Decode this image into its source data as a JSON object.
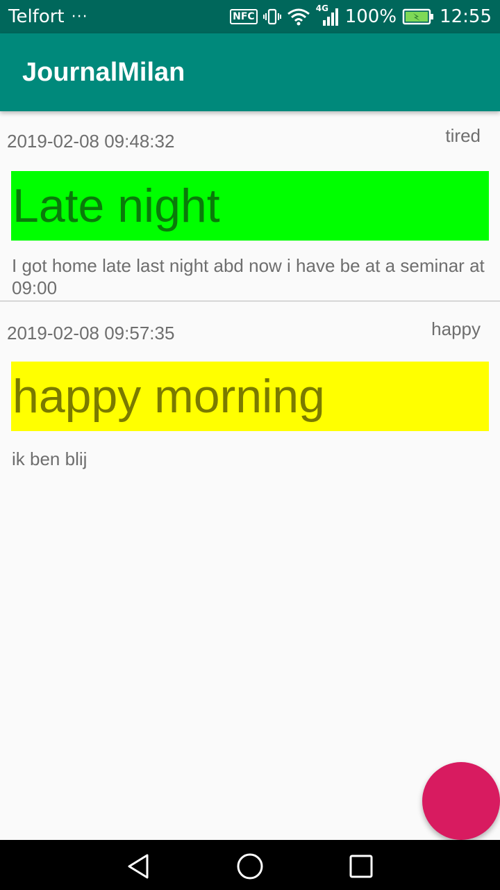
{
  "status_bar": {
    "carrier": "Telfort",
    "carrier_extra": "···",
    "nfc_label": "NFC",
    "network_label": "4G",
    "battery": "100%",
    "time": "12:55",
    "icons": [
      "nfc-icon",
      "vibrate-icon",
      "wifi-icon",
      "signal-icon",
      "battery-charging-icon"
    ]
  },
  "app_bar": {
    "title": "JournalMilan",
    "color": "#00897b"
  },
  "entries": [
    {
      "timestamp": "2019-02-08 09:48:32",
      "mood": "tired",
      "title": "Late night",
      "title_bg": "#00ff00",
      "title_color": "#0a7a0a",
      "body": "I got home late last night abd now i have be at a seminar at 09:00"
    },
    {
      "timestamp": "2019-02-08 09:57:35",
      "mood": "happy",
      "title": "happy morning",
      "title_bg": "#ffff00",
      "title_color": "#7a7a00",
      "body": "ik ben blij"
    }
  ],
  "fab": {
    "color": "#d81b60"
  },
  "nav_bar": {
    "icons": [
      "back-icon",
      "home-icon",
      "recents-icon"
    ]
  }
}
